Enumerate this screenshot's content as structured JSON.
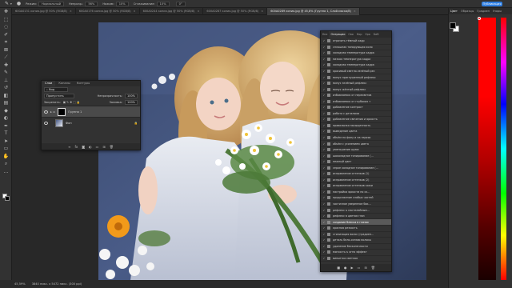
{
  "options_bar": {
    "mode_label": "Режим:",
    "mode_value": "Нормальный",
    "opacity_label": "Непрозр.:",
    "opacity_value": "56%",
    "pressure_label": "Нажим:",
    "pressure_value": "10%",
    "smoothing_label": "Сглаживание:",
    "smoothing_value": "10%",
    "angle_value": "0°",
    "share_label": "Публикация"
  },
  "doc_tabs": [
    {
      "label": "600A0131 копия.jpg @ 50% (RGB/8)",
      "active": false
    },
    {
      "label": "600A0176 копия.jpg @ 50% (RGB/8)",
      "active": false
    },
    {
      "label": "600A0244 копия.jpg @ 50% (RGB/8)",
      "active": false
    },
    {
      "label": "600A0287 копия.jpg @ 50% (RGB/8)",
      "active": false
    },
    {
      "label": "600A0289 копия.jpg @ 45,8% (Группа 1, Слой-маска/8)",
      "active": true
    }
  ],
  "status_bar": {
    "zoom": "45,59%",
    "doc_size": "3840 пикс. x 5472 пикс. (300 ppi)"
  },
  "layers_panel": {
    "tabs": [
      "Слои",
      "Каналы",
      "Контуры"
    ],
    "filter_label": "Вид",
    "blend_mode": "Пропустить",
    "opacity_label": "Непрозрачность:",
    "opacity_value": "100%",
    "lock_label": "Закрепить:",
    "fill_label": "Заливка:",
    "fill_value": "100%",
    "layers": [
      {
        "name": "Группа 1",
        "selected": true
      },
      {
        "name": "Фон",
        "selected": false
      }
    ]
  },
  "history_panel": {
    "tabs": [
      "Кис",
      "Операции",
      "Сво",
      "Кор",
      "Уро",
      "Биб"
    ],
    "active_tab": 1,
    "items": [
      "отразить тёмный кадр",
      "сплошная тонирующая холо",
      "холодная температура кадра",
      "низкая температура кадра",
      "холодная температура кадра",
      "красивый светло-зелёный рес",
      "минус приглушенный рефлекс",
      "минус зелёный рефлекс",
      "минус жёлтый рефлекс",
      "избавляемся от пересветов",
      "избавляемся от глубоких т",
      "добавление контраст",
      "работа с деталями",
      "добавление свечения и яркость",
      "правильная насыщенность",
      "выведение цвета",
      "объём по фону и на героях",
      "объём с усилением цвета",
      "уменьшение шума",
      "шоколадное тонирование (...",
      "нежный цвет",
      "серое холодное тонирование (...",
      "исправление оттенков (1)",
      "исправление оттенков (2)",
      "исправление оттенков кожи",
      "настройка яркости по ск...",
      "продолжение слабых частей",
      "частичное уверенное бок...",
      "рефлекс ъ пастелейным...",
      "рефлекс в цветов глаз",
      "создание блеска в глазах",
      "красная резкость",
      "стилизация волос (градиен...",
      "деталь бело-синюю волосы",
      "удаление бесконечности",
      "мягкость ъ огня эффект",
      "виньетка светлая",
      "виньетка тёмная",
      "виньетка тёмная",
      "увеличение резкости"
    ],
    "active_index": 30
  },
  "right_panel": {
    "tabs": [
      "Цвет",
      "Образцы",
      "Градиен",
      "Узоры"
    ],
    "accent": "#ff0000"
  },
  "tool_icons": [
    "move-icon",
    "marquee-icon",
    "lasso-icon",
    "quick-select-icon",
    "crop-icon",
    "frame-icon",
    "eyedropper-icon",
    "healing-icon",
    "brush-icon",
    "stamp-icon",
    "history-brush-icon",
    "eraser-icon",
    "gradient-icon",
    "blur-icon",
    "dodge-icon",
    "pen-icon",
    "type-icon",
    "path-select-icon",
    "shape-icon",
    "hand-icon",
    "zoom-icon",
    "more-icon"
  ]
}
